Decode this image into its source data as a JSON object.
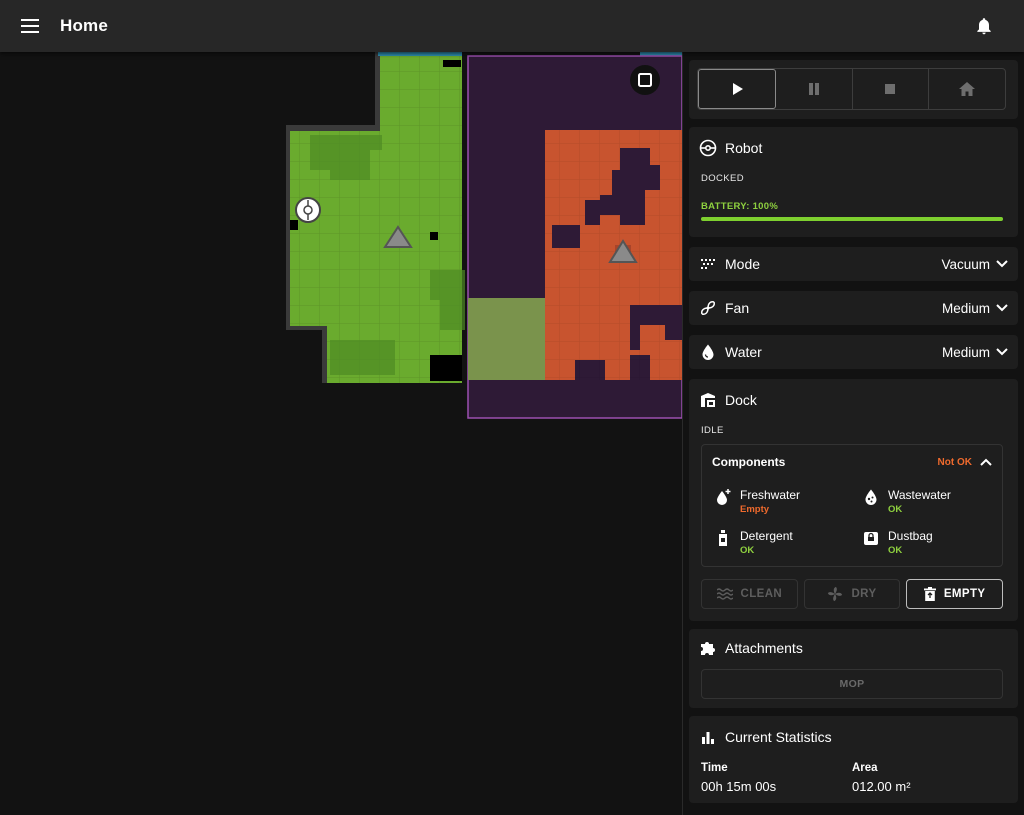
{
  "appbar": {
    "title": "Home"
  },
  "robot": {
    "title": "Robot",
    "status": "DOCKED",
    "battery_label": "BATTERY: 100%",
    "battery_percent": 100
  },
  "mode": {
    "label": "Mode",
    "value": "Vacuum"
  },
  "fan": {
    "label": "Fan",
    "value": "Medium"
  },
  "water": {
    "label": "Water",
    "value": "Medium"
  },
  "dock": {
    "title": "Dock",
    "status": "IDLE",
    "components_title": "Components",
    "components_status": "Not OK",
    "components": [
      {
        "name": "Freshwater",
        "state": "Empty"
      },
      {
        "name": "Wastewater",
        "state": "OK"
      },
      {
        "name": "Detergent",
        "state": "OK"
      },
      {
        "name": "Dustbag",
        "state": "OK"
      }
    ],
    "actions": {
      "clean": "CLEAN",
      "dry": "DRY",
      "empty": "EMPTY"
    }
  },
  "attachments": {
    "title": "Attachments",
    "mop": "MOP"
  },
  "stats": {
    "title": "Current Statistics",
    "time_label": "Time",
    "time_value": "00h 15m 00s",
    "area_label": "Area",
    "area_value": "012.00 m²"
  },
  "colors": {
    "room_green": "#6aab2e",
    "room_red": "#c8542f",
    "room_blue": "#2d8fb3",
    "zone_purple": "#2e1a36",
    "ok_green": "#8fd13f",
    "warn_orange": "#ef6a2d"
  }
}
